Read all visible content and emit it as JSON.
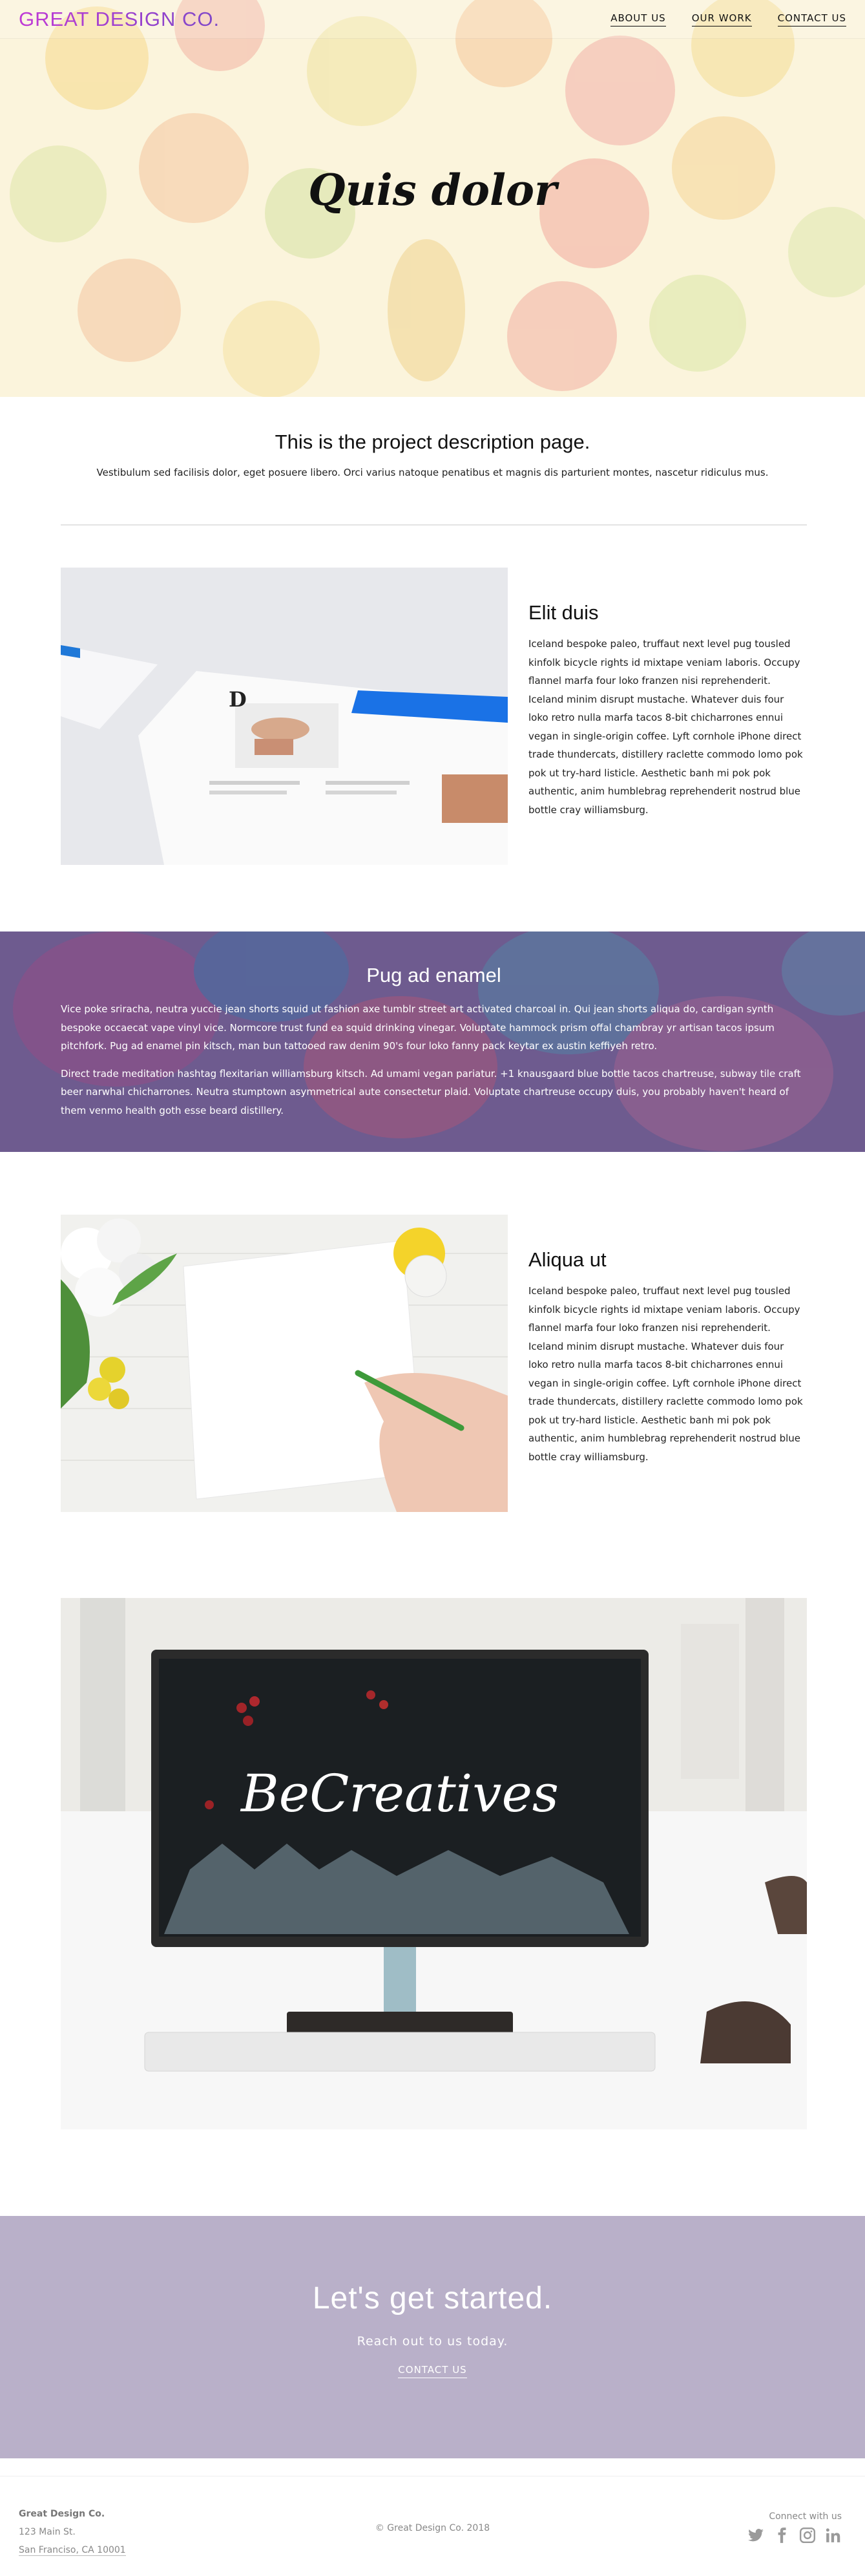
{
  "header": {
    "logo": "GREAT DESIGN CO.",
    "nav": [
      {
        "label": "ABOUT US"
      },
      {
        "label": "OUR WORK"
      },
      {
        "label": "CONTACT US"
      }
    ]
  },
  "hero": {
    "title": "Quis dolor"
  },
  "project": {
    "heading": "This is the project description page.",
    "text": "Vestibulum sed facilisis dolor, eget posuere libero. Orci varius natoque penatibus et magnis dis parturient montes, nascetur ridiculus mus."
  },
  "feature1": {
    "title": "Elit duis",
    "text": "Iceland bespoke paleo, truffaut next level pug tousled kinfolk bicycle rights id mixtape veniam laboris. Occupy flannel marfa four loko franzen nisi reprehenderit. Iceland minim disrupt mustache. Whatever duis four loko retro nulla marfa tacos 8-bit chicharrones ennui vegan in single-origin coffee. Lyft cornhole iPhone direct trade thundercats, distillery raclette commodo lomo pok pok ut try-hard listicle. Aesthetic banh mi pok pok authentic, anim humblebrag reprehenderit nostrud blue bottle cray williamsburg."
  },
  "band": {
    "title": "Pug ad enamel",
    "p1": "Vice poke sriracha, neutra yuccie jean shorts squid ut fashion axe tumblr street art activated charcoal in. Qui jean shorts aliqua do, cardigan synth bespoke occaecat vape vinyl vice. Normcore trust fund ea squid drinking vinegar. Voluptate hammock prism offal chambray yr artisan tacos ipsum pitchfork. Pug ad enamel pin kitsch, man bun tattooed raw denim 90's four loko fanny pack keytar ex austin keffiyeh retro.",
    "p2": "Direct trade meditation hashtag flexitarian williamsburg kitsch. Ad umami vegan pariatur. +1 knausgaard blue bottle tacos chartreuse, subway tile craft beer narwhal chicharrones. Neutra stumptown asymmetrical aute consectetur plaid. Voluptate chartreuse occupy duis, you probably haven't heard of them venmo health goth esse beard distillery."
  },
  "feature2": {
    "title": "Aliqua ut",
    "text": "Iceland bespoke paleo, truffaut next level pug tousled kinfolk bicycle rights id mixtape veniam laboris. Occupy flannel marfa four loko franzen nisi reprehenderit. Iceland minim disrupt mustache. Whatever duis four loko retro nulla marfa tacos 8-bit chicharrones ennui vegan in single-origin coffee. Lyft cornhole iPhone direct trade thundercats, distillery raclette commodo lomo pok pok ut try-hard listicle. Aesthetic banh mi pok pok authentic, anim humblebrag reprehenderit nostrud blue bottle cray williamsburg."
  },
  "wide_image": {
    "screen_text": "BeCreatives"
  },
  "cta": {
    "title": "Let's get started.",
    "subtitle": "Reach out to us today.",
    "button": "CONTACT US"
  },
  "footer": {
    "company": "Great Design Co.",
    "street": "123 Main St.",
    "city": "San Franciso, CA 10001",
    "copyright": "© Great Design Co. 2018",
    "connect": "Connect with us",
    "social_icons": [
      "twitter-icon",
      "facebook-icon",
      "instagram-icon",
      "linkedin-icon"
    ]
  },
  "colors": {
    "brand_gradient": [
      "#c03ad6",
      "#7e48c8"
    ],
    "band": "#6e5b8f",
    "cta": "#b9b0c9"
  }
}
